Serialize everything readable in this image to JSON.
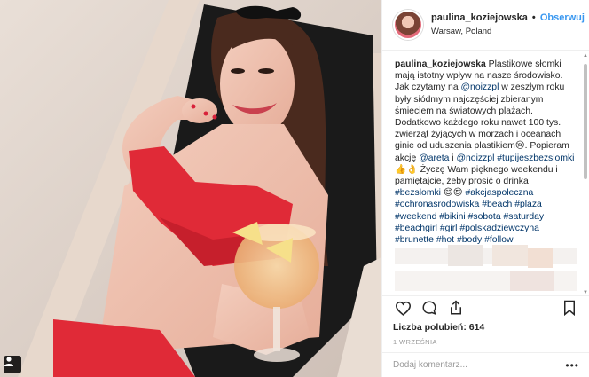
{
  "header": {
    "username": "paulina_koziejowska",
    "separator": "•",
    "follow_label": "Obserwuj",
    "location": "Warsaw, Poland"
  },
  "caption": {
    "username": "paulina_koziejowska",
    "parts": [
      {
        "t": "text",
        "v": " Plastikowe słomki mają istotny wpływ na nasze środowisko. Jak czytamy na "
      },
      {
        "t": "tag",
        "v": "@noizzpl"
      },
      {
        "t": "text",
        "v": " w zeszłym roku były siódmym najczęściej zbieranym śmieciem na światowych plażach. Dodatkowo każdego roku nawet 100 tys. zwierząt żyjących w morzach i oceanach ginie od uduszenia plastikiem😢. Popieram akcję "
      },
      {
        "t": "tag",
        "v": "@areta"
      },
      {
        "t": "text",
        "v": " i "
      },
      {
        "t": "tag",
        "v": "@noizzpl"
      },
      {
        "t": "text",
        "v": " "
      },
      {
        "t": "tag",
        "v": "#tupijeszbezslomki"
      },
      {
        "t": "text",
        "v": " 👍👌 Życzę Wam pięknego weekendu i pamiętajcie, żeby prosić o drinka "
      },
      {
        "t": "tag",
        "v": "#bezslomki"
      },
      {
        "t": "text",
        "v": " 😊😍 "
      },
      {
        "t": "tag",
        "v": "#akcjaspołeczna"
      },
      {
        "t": "text",
        "v": " "
      },
      {
        "t": "tag",
        "v": "#ochronasrodowiska"
      },
      {
        "t": "text",
        "v": " "
      },
      {
        "t": "tag",
        "v": "#beach"
      },
      {
        "t": "text",
        "v": " "
      },
      {
        "t": "tag",
        "v": "#plaza"
      },
      {
        "t": "text",
        "v": " "
      },
      {
        "t": "tag",
        "v": "#weekend"
      },
      {
        "t": "text",
        "v": " "
      },
      {
        "t": "tag",
        "v": "#bikini"
      },
      {
        "t": "text",
        "v": " "
      },
      {
        "t": "tag",
        "v": "#sobota"
      },
      {
        "t": "text",
        "v": " "
      },
      {
        "t": "tag",
        "v": "#saturday"
      },
      {
        "t": "text",
        "v": " "
      },
      {
        "t": "tag",
        "v": "#beachgirl"
      },
      {
        "t": "text",
        "v": " "
      },
      {
        "t": "tag",
        "v": "#girl"
      },
      {
        "t": "text",
        "v": " "
      },
      {
        "t": "tag",
        "v": "#polskadziewczyna"
      },
      {
        "t": "text",
        "v": " "
      },
      {
        "t": "tag",
        "v": "#brunette"
      },
      {
        "t": "text",
        "v": " "
      },
      {
        "t": "tag",
        "v": "#hot"
      },
      {
        "t": "text",
        "v": " "
      },
      {
        "t": "tag",
        "v": "#body"
      },
      {
        "t": "text",
        "v": " "
      },
      {
        "t": "tag",
        "v": "#follow"
      }
    ]
  },
  "actions": {
    "icons": [
      "heart-icon",
      "comment-icon",
      "share-icon",
      "bookmark-icon"
    ],
    "likes_label": "Liczba polubień: 614",
    "date_label": "1 WRZEŚNIA",
    "comment_placeholder": "Dodaj komentarz...",
    "more_label": "•••"
  },
  "colors": {
    "link": "#3897f0",
    "hashtag": "#003569",
    "border": "#efefef",
    "muted": "#999999"
  }
}
